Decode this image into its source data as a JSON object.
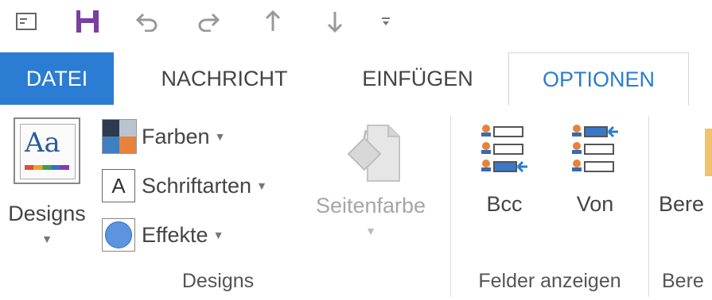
{
  "quick_access": {
    "icons": [
      "message-icon",
      "save-icon",
      "undo-icon",
      "redo-icon",
      "up-arrow-icon",
      "down-arrow-icon",
      "customize-icon"
    ]
  },
  "tabs": [
    {
      "label": "DATEI"
    },
    {
      "label": "NACHRICHT"
    },
    {
      "label": "EINFÜGEN"
    },
    {
      "label": "OPTIONEN"
    }
  ],
  "ribbon": {
    "designs_group": {
      "designs_button": "Designs",
      "farben": "Farben",
      "schriftarten": "Schriftarten",
      "effekte": "Effekte",
      "seitenfarbe": "Seitenfarbe",
      "label": "Designs"
    },
    "felder_group": {
      "bcc": "Bcc",
      "von": "Von",
      "label": "Felder anzeigen"
    },
    "next_group": {
      "button_partial": "Bere",
      "label_partial": "Bere"
    }
  },
  "colors": {
    "accent": "#2b7cd3",
    "save": "#7a3fa0"
  }
}
